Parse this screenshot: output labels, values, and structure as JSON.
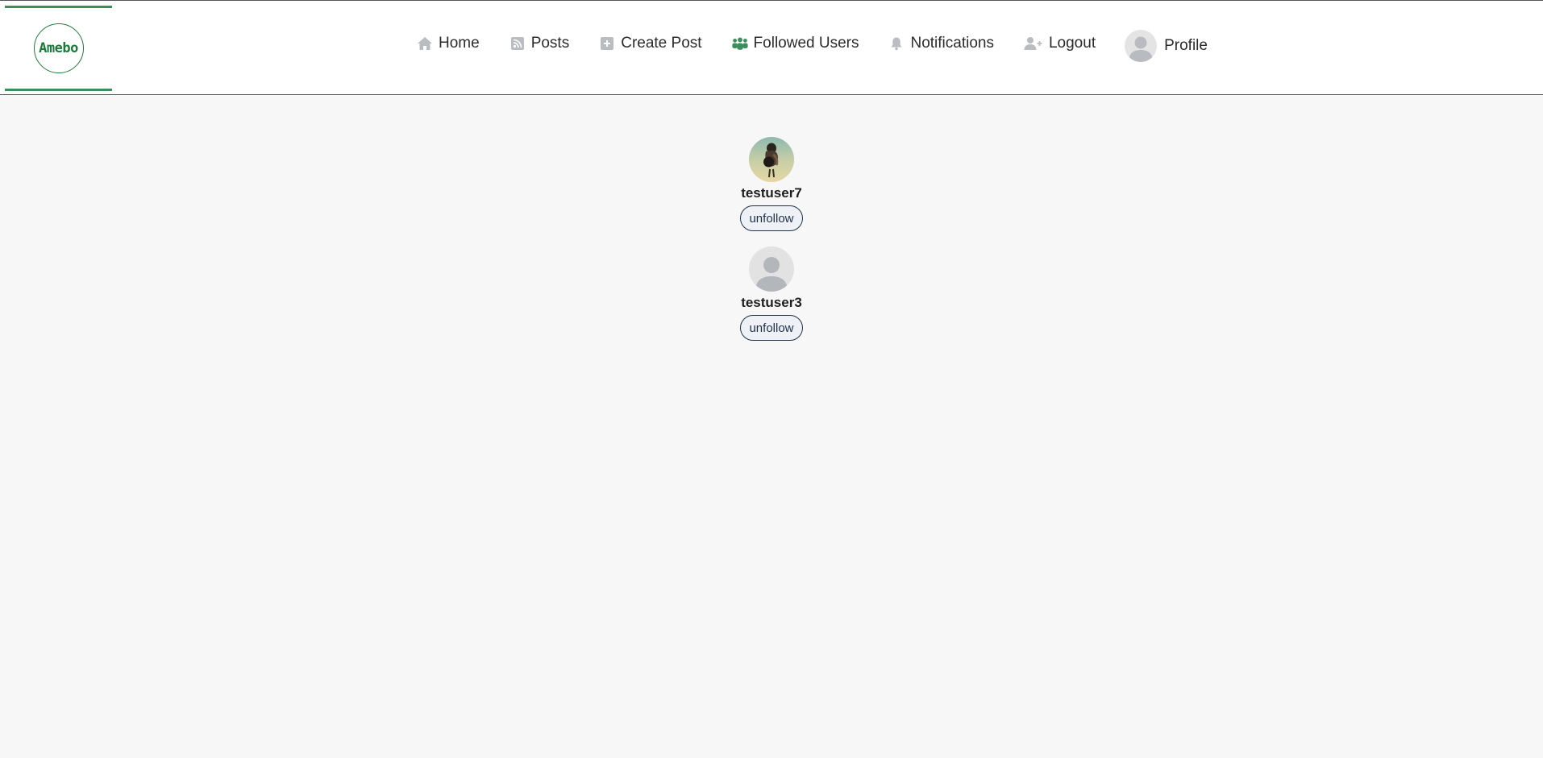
{
  "brand": {
    "logo_text": "Amebo",
    "accent": "#3c8f5a"
  },
  "nav": {
    "items": [
      {
        "label": "Home",
        "icon": "home-icon"
      },
      {
        "label": "Posts",
        "icon": "rss-icon"
      },
      {
        "label": "Create Post",
        "icon": "plus-square-icon"
      },
      {
        "label": "Followed Users",
        "icon": "users-icon",
        "icon_color": "#3c8f5a"
      },
      {
        "label": "Notifications",
        "icon": "bell-icon"
      },
      {
        "label": "Logout",
        "icon": "user-plus-icon"
      }
    ],
    "profile_label": "Profile"
  },
  "followed_users": [
    {
      "username": "testuser7",
      "button_label": "unfollow",
      "avatar": "photo"
    },
    {
      "username": "testuser3",
      "button_label": "unfollow",
      "avatar": "default"
    }
  ]
}
